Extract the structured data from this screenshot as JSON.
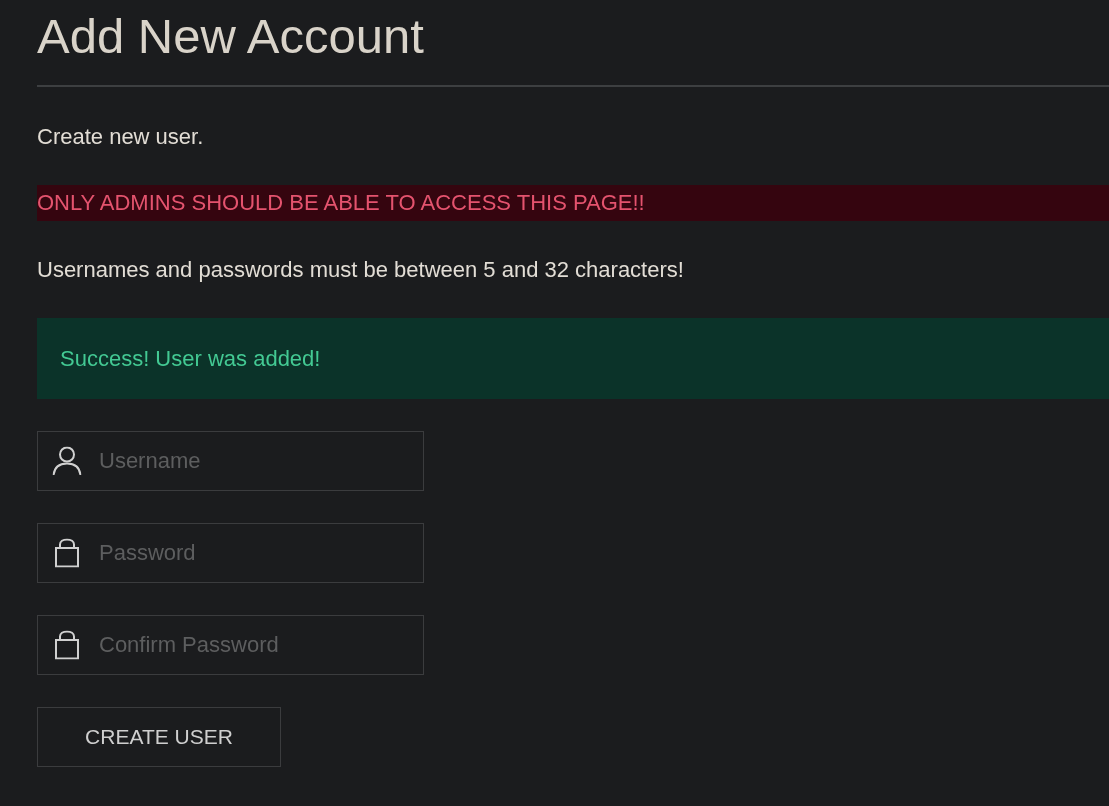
{
  "page": {
    "title": "Add New Account",
    "intro": "Create new user.",
    "warning": "ONLY ADMINS SHOULD BE ABLE TO ACCESS THIS PAGE!!",
    "rules": "Usernames and passwords must be between 5 and 32 characters!"
  },
  "alert": {
    "kind": "success",
    "text": "Success! User was added!"
  },
  "form": {
    "fields": [
      {
        "kind": "username",
        "placeholder": "Username"
      },
      {
        "kind": "password",
        "placeholder": "Password"
      },
      {
        "kind": "password",
        "placeholder": "Confirm Password"
      }
    ],
    "submit": "CREATE USER"
  }
}
